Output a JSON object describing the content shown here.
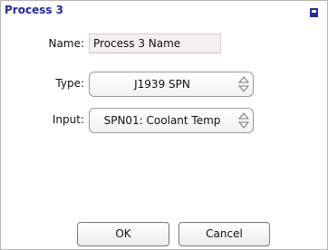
{
  "dialog": {
    "title": "Process 3"
  },
  "form": {
    "name_label": "Name:",
    "name_value": "Process 3 Name",
    "type_label": "Type:",
    "type_value": "J1939 SPN",
    "input_label": "Input:",
    "input_value": "SPN01: Coolant Temp"
  },
  "buttons": {
    "ok_label": "OK",
    "cancel_label": "Cancel"
  },
  "colors": {
    "title": "#1f2aa6",
    "corner_icon": "#1f2aa6",
    "name_field_bg": "#f6efef"
  },
  "icons": {
    "corner": "window-icon",
    "select_arrows": "up-down-arrows-icon"
  }
}
